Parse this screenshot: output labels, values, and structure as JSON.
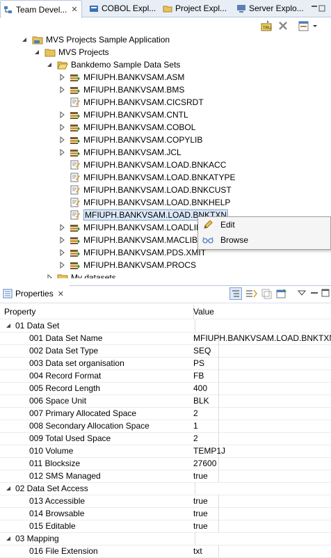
{
  "tabs": [
    {
      "label": "Team Devel...",
      "icon": "team-developer-icon",
      "active": true
    },
    {
      "label": "COBOL Expl...",
      "icon": "cobol-explorer-icon",
      "active": false
    },
    {
      "label": "Project Expl...",
      "icon": "project-explorer-icon",
      "active": false
    },
    {
      "label": "Server Explo...",
      "icon": "server-explorer-icon",
      "active": false
    }
  ],
  "tab_close": "✕",
  "tree": {
    "root": "MVS Projects Sample Application",
    "projects": "MVS Projects",
    "sample": "Bankdemo Sample Data Sets",
    "items": [
      "MFIUPH.BANKVSAM.ASM",
      "MFIUPH.BANKVSAM.BMS",
      "MFIUPH.BANKVSAM.CICSRDT",
      "MFIUPH.BANKVSAM.CNTL",
      "MFIUPH.BANKVSAM.COBOL",
      "MFIUPH.BANKVSAM.COPYLIB",
      "MFIUPH.BANKVSAM.JCL",
      "MFIUPH.BANKVSAM.LOAD.BNKACC",
      "MFIUPH.BANKVSAM.LOAD.BNKATYPE",
      "MFIUPH.BANKVSAM.LOAD.BNKCUST",
      "MFIUPH.BANKVSAM.LOAD.BNKHELP",
      "MFIUPH.BANKVSAM.LOAD.BNKTXN",
      "MFIUPH.BANKVSAM.LOADLIB",
      "MFIUPH.BANKVSAM.MACLIB",
      "MFIUPH.BANKVSAM.PDS.XMIT",
      "MFIUPH.BANKVSAM.PROCS"
    ],
    "my_datasets": "My datasets"
  },
  "context_menu": {
    "edit": "Edit",
    "browse": "Browse"
  },
  "properties": {
    "tab_label": "Properties",
    "col_property": "Property",
    "col_value": "Value",
    "groups": {
      "g1": "01 Data Set",
      "g2": "02 Data Set Access",
      "g3": "03 Mapping"
    },
    "rows": [
      {
        "name": "001 Data Set Name",
        "value": "MFIUPH.BANKVSAM.LOAD.BNKTXN"
      },
      {
        "name": "002 Data Set Type",
        "value": "SEQ"
      },
      {
        "name": "003 Data set organisation",
        "value": "PS"
      },
      {
        "name": "004 Record Format",
        "value": "FB"
      },
      {
        "name": "005 Record Length",
        "value": "400"
      },
      {
        "name": "006 Space Unit",
        "value": "BLK"
      },
      {
        "name": "007 Primary Allocated Space",
        "value": "2"
      },
      {
        "name": "008 Secondary Allocation Space",
        "value": "1"
      },
      {
        "name": "009 Total Used Space",
        "value": "2"
      },
      {
        "name": "010 Volume",
        "value": "TEMP1J"
      },
      {
        "name": "011 Blocksize",
        "value": "27600"
      },
      {
        "name": "012 SMS Managed",
        "value": "true"
      },
      {
        "name": "013 Accessible",
        "value": "true"
      },
      {
        "name": "014 Browsable",
        "value": "true"
      },
      {
        "name": "015 Editable",
        "value": "true"
      },
      {
        "name": "016 File Extension",
        "value": "txt"
      }
    ]
  },
  "colors": {
    "selection": "#dce9f8",
    "tab_bar": "#e8eef6",
    "border": "#b9c7d9"
  }
}
